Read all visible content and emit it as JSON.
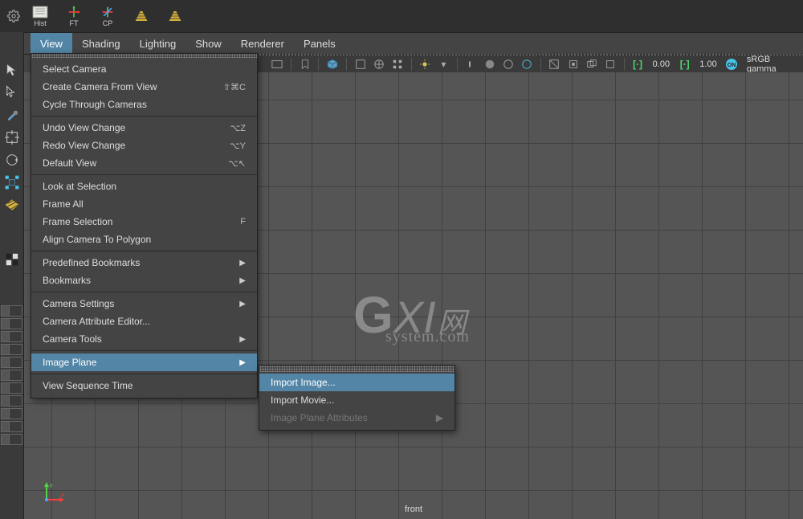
{
  "shelf": {
    "hist": "Hist",
    "ft": "FT",
    "cp": "CP"
  },
  "menubar": [
    "View",
    "Shading",
    "Lighting",
    "Show",
    "Renderer",
    "Panels"
  ],
  "toolbar": {
    "val1": "0.00",
    "val2": "1.00",
    "colorspace": "sRGB gamma"
  },
  "viewport": {
    "camera": "front"
  },
  "watermark": {
    "main_g": "G",
    "main_xi": "XI",
    "main_w": "网",
    "sub": "system.com"
  },
  "dropdown": {
    "groups": [
      [
        {
          "label": "Select Camera"
        },
        {
          "label": "Create Camera From View",
          "shortcut": "⇧⌘C"
        },
        {
          "label": "Cycle Through Cameras"
        }
      ],
      [
        {
          "label": "Undo View Change",
          "shortcut": "⌥Z"
        },
        {
          "label": "Redo View Change",
          "shortcut": "⌥Y"
        },
        {
          "label": "Default View",
          "shortcut": "⌥↖"
        }
      ],
      [
        {
          "label": "Look at Selection"
        },
        {
          "label": "Frame All"
        },
        {
          "label": "Frame Selection",
          "shortcut": "F"
        },
        {
          "label": "Align Camera To Polygon"
        }
      ],
      [
        {
          "label": "Predefined Bookmarks",
          "submenu": true
        },
        {
          "label": "Bookmarks",
          "submenu": true
        }
      ],
      [
        {
          "label": "Camera Settings",
          "submenu": true
        },
        {
          "label": "Camera Attribute Editor..."
        },
        {
          "label": "Camera Tools",
          "submenu": true
        }
      ],
      [
        {
          "label": "Image Plane",
          "submenu": true,
          "highlight": true
        }
      ],
      [
        {
          "label": "View Sequence Time"
        }
      ]
    ]
  },
  "submenu": [
    {
      "label": "Import Image...",
      "highlight": true
    },
    {
      "label": "Import Movie..."
    },
    {
      "label": "Image Plane Attributes",
      "submenu": true,
      "disabled": true
    }
  ]
}
